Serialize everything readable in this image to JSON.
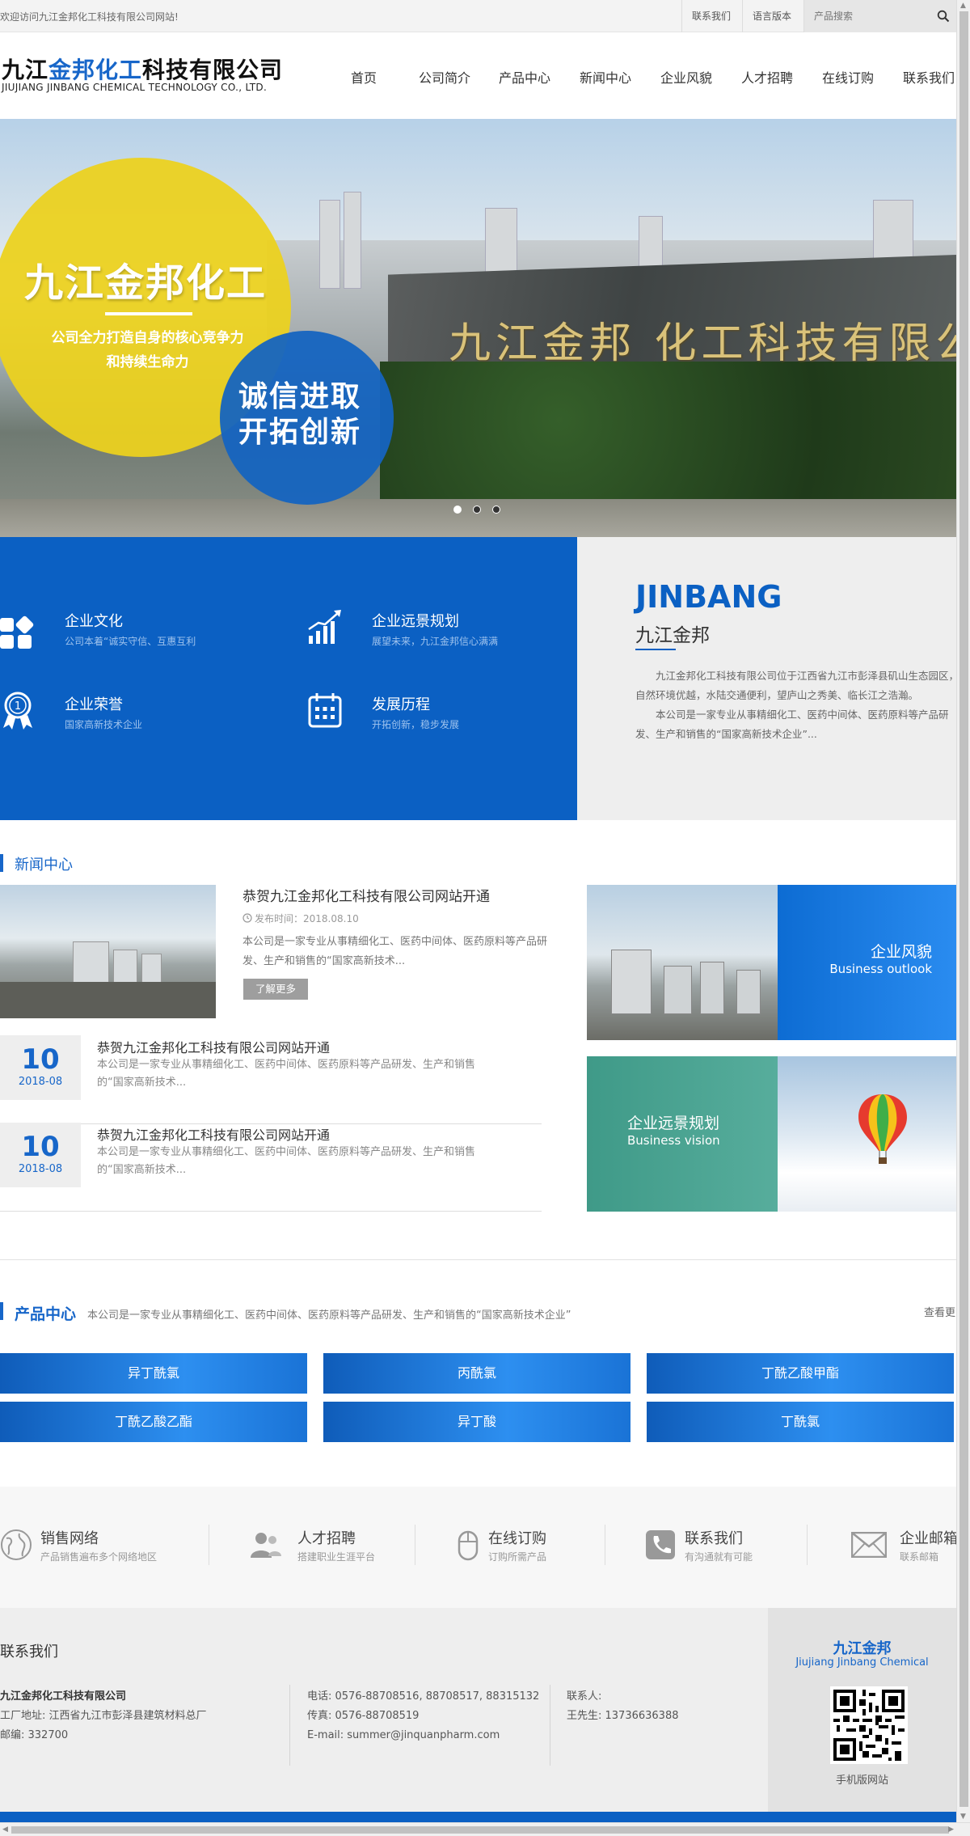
{
  "topbar": {
    "welcome": "欢迎访问九江金邦化工科技有限公司网站!",
    "contact": "联系我们",
    "language": "语言版本",
    "search_placeholder": "产品搜索"
  },
  "header": {
    "logo_part1": "九江",
    "logo_part2": "金邦化工",
    "logo_part3": "科技有限公司",
    "logo_en": "JIUJIANG JINBANG CHEMICAL TECHNOLOGY CO., LTD.",
    "nav": [
      "首页",
      "公司简介",
      "产品中心",
      "新闻中心",
      "企业风貌",
      "人才招聘",
      "在线订购",
      "联系我们"
    ]
  },
  "banner": {
    "title": "九江金邦化工",
    "subtitle_line1": "公司全力打造自身的核心竞争力",
    "subtitle_line2": "和持续生命力",
    "slogan_line1": "诚信进取",
    "slogan_line2": "开拓创新",
    "wall_text": "九江金邦 化工科技有限公",
    "slides": 3,
    "active_slide": 1
  },
  "culture": [
    {
      "title": "企业文化",
      "sub": "公司本着“诚实守信、互惠互利",
      "icon": "blocks-icon"
    },
    {
      "title": "企业远景规划",
      "sub": "展望未来，九江金邦信心满满",
      "icon": "growth-chart-icon"
    },
    {
      "title": "企业荣誉",
      "sub": "国家高新技术企业",
      "icon": "medal-icon"
    },
    {
      "title": "发展历程",
      "sub": "开拓创新，稳步发展",
      "icon": "calendar-icon"
    }
  ],
  "about": {
    "en": "JINBANG",
    "cn": "九江金邦",
    "p1": "九江金邦化工科技有限公司位于江西省九江市彭泽县矶山生态园区，自然环境优越，水陆交通便利，望庐山之秀美、临长江之浩瀚。",
    "p2": "本公司是一家专业从事精细化工、医药中间体、医药原料等产品研发、生产和销售的“国家高新技术企业”..."
  },
  "news": {
    "section_title": "新闻中心",
    "headline": "恭贺九江金邦化工科技有限公司网站开通",
    "date_label": "发布时间：2018.08.10",
    "desc": "本公司是一家专业从事精细化工、医药中间体、医药原料等产品研发、生产和销售的“国家高新技术...",
    "more": "了解更多",
    "items": [
      {
        "day": "10",
        "ym": "2018-08",
        "title": "恭贺九江金邦化工科技有限公司网站开通",
        "desc": "本公司是一家专业从事精细化工、医药中间体、医药原料等产品研发、生产和销售的“国家高新技术..."
      },
      {
        "day": "10",
        "ym": "2018-08",
        "title": "恭贺九江金邦化工科技有限公司网站开通",
        "desc": "本公司是一家专业从事精细化工、医药中间体、医药原料等产品研发、生产和销售的“国家高新技术..."
      }
    ]
  },
  "features": [
    {
      "cn": "企业风貌",
      "en": "Business outlook",
      "color": "#1a7de0"
    },
    {
      "cn": "企业远景规划",
      "en": "Business vision",
      "color": "#4aa191"
    }
  ],
  "products": {
    "title": "产品中心",
    "desc": "本公司是一家专业从事精细化工、医药中间体、医药原料等产品研发、生产和销售的“国家高新技术企业”",
    "more": "查看更多",
    "items": [
      "异丁酰氯",
      "丙酰氯",
      "丁酰乙酸甲酯",
      "丁酰乙酸乙酯",
      "异丁酸",
      "丁酰氯"
    ]
  },
  "services": [
    {
      "title": "销售网络",
      "sub": "产品销售遍布多个网络地区",
      "icon": "globe-icon"
    },
    {
      "title": "人才招聘",
      "sub": "搭建职业生涯平台",
      "icon": "people-icon"
    },
    {
      "title": "在线订购",
      "sub": "订购所需产品",
      "icon": "mouse-icon"
    },
    {
      "title": "联系我们",
      "sub": "有沟通就有可能",
      "icon": "phone-icon"
    },
    {
      "title": "企业邮箱",
      "sub": "联系邮箱",
      "icon": "mail-icon"
    }
  ],
  "footer": {
    "heading": "联系我们",
    "company": "九江金邦化工科技有限公司",
    "address": "工厂地址: 江西省九江市彭泽县建筑材料总厂",
    "postcode": "邮编: 332700",
    "tel": "电话: 0576-88708516, 88708517, 88315132",
    "fax": "传真: 0576-88708519",
    "email": "E-mail: summer@jinquanpharm.com",
    "contact_label": "联系人:",
    "contact_person": "王先生: 13736636388",
    "qr_cn": "九江金邦",
    "qr_en": "Jiujiang Jinbang Chemical",
    "qr_label": "手机版网站"
  },
  "colors": {
    "brand_blue": "#0b60c3",
    "teal": "#4aa191",
    "yellow": "#ecd11e"
  }
}
